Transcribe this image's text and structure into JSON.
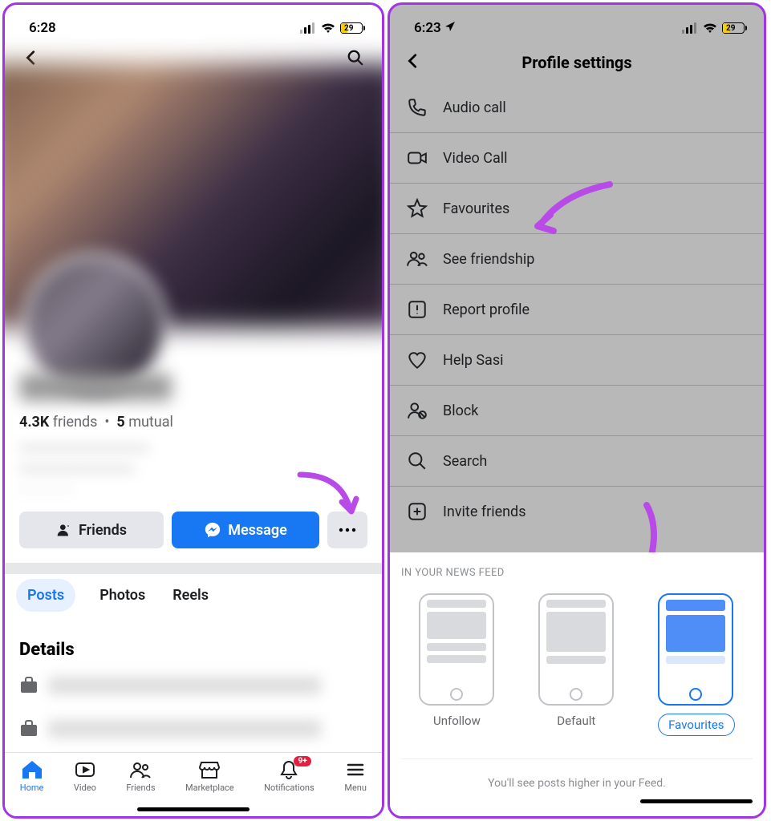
{
  "left": {
    "status": {
      "time": "6:28",
      "battery": "29"
    },
    "friends_count": "4.3K",
    "friends_label": "friends",
    "mutual_count": "5",
    "mutual_label": "mutual",
    "actions": {
      "friends": "Friends",
      "message": "Message"
    },
    "tabs": {
      "posts": "Posts",
      "photos": "Photos",
      "reels": "Reels"
    },
    "details_heading": "Details",
    "bottom_nav": {
      "home": "Home",
      "video": "Video",
      "friends": "Friends",
      "marketplace": "Marketplace",
      "notifications": "Notifications",
      "menu": "Menu",
      "badge": "9+"
    }
  },
  "right": {
    "status": {
      "time": "6:23",
      "battery": "29"
    },
    "title": "Profile settings",
    "items": {
      "audio": "Audio call",
      "video": "Video Call",
      "fav": "Favourites",
      "friendship": "See friendship",
      "report": "Report profile",
      "help": "Help Sasi",
      "block": "Block",
      "search": "Search",
      "invite": "Invite friends"
    },
    "sheet": {
      "heading": "IN YOUR NEWS FEED",
      "unfollow": "Unfollow",
      "default": "Default",
      "favourites": "Favourites",
      "footer": "You'll see posts higher in your Feed."
    }
  }
}
